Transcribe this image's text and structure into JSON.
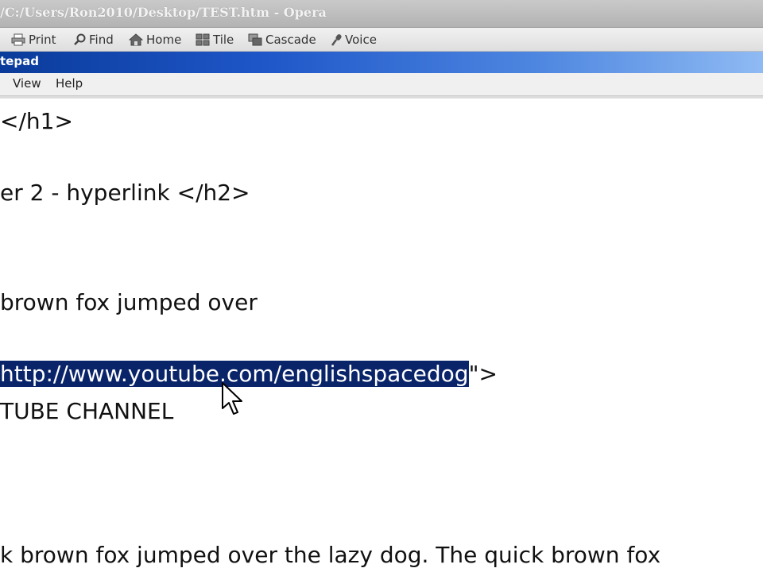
{
  "browser": {
    "title": "/C:/Users/Ron2010/Desktop/TEST.htm - Opera",
    "toolbar": {
      "print": "Print",
      "find": "Find",
      "home": "Home",
      "tile": "Tile",
      "cascade": "Cascade",
      "voice": "Voice"
    }
  },
  "notepad": {
    "title": "tepad",
    "menu": {
      "view": "View",
      "help": "Help"
    }
  },
  "editor": {
    "line_h1_end": "</h1>",
    "line_h2": "er 2 - hyperlink </h2>",
    "line_fox": " brown fox jumped over",
    "link_selected": "http://www.youtube.com/englishspacedog",
    "link_tail": "\">",
    "line_channel": "TUBE CHANNEL",
    "line_bottom": "k brown fox jumped over the lazy dog. The quick brown fox"
  },
  "colors": {
    "selection": "#0a246a",
    "notepad_title_bar": "#1f57c9"
  }
}
